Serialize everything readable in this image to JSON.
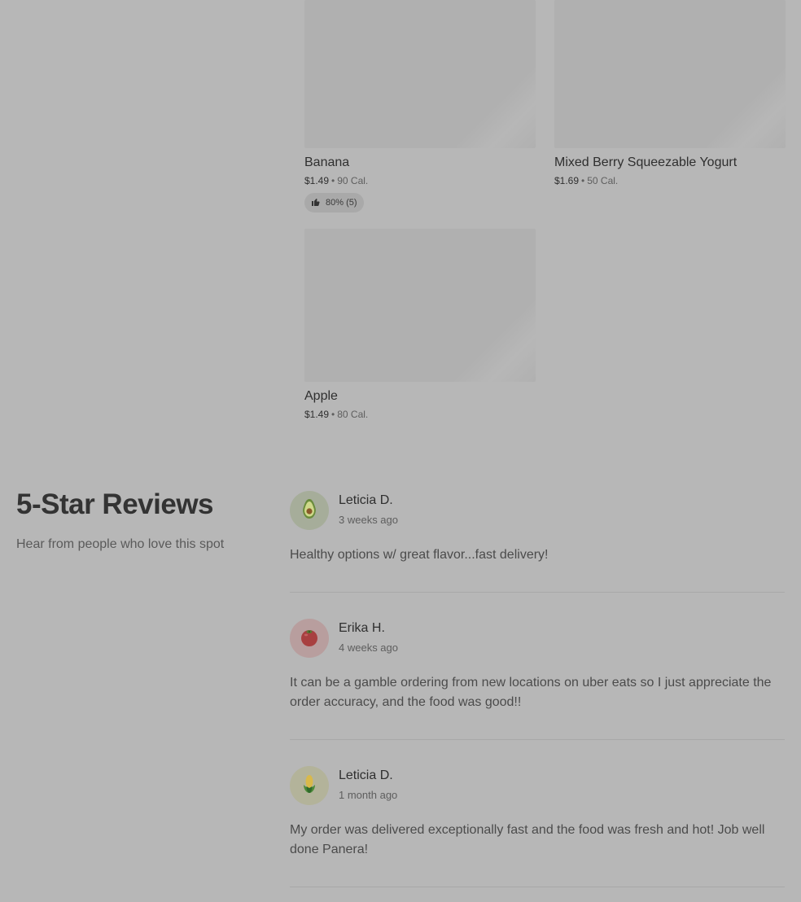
{
  "products": [
    {
      "name": "Banana",
      "price": "$1.49",
      "separator": "•",
      "calories": "90 Cal.",
      "rating": {
        "text": "80% (5)",
        "icon": "thumbs-up-icon"
      }
    },
    {
      "name": "Mixed Berry Squeezable Yogurt",
      "price": "$1.69",
      "separator": "•",
      "calories": "50 Cal."
    },
    {
      "name": "Apple",
      "price": "$1.49",
      "separator": "•",
      "calories": "80 Cal."
    }
  ],
  "reviews_section": {
    "title": "5-Star Reviews",
    "subtitle": "Hear from people who love this spot"
  },
  "reviews": [
    {
      "author": "Leticia D.",
      "time": "3 weeks ago",
      "text": "Healthy options w/ great flavor...fast delivery!",
      "avatar": "avocado-icon",
      "avatar_bg": "#a6ad9a"
    },
    {
      "author": "Erika H.",
      "time": "4 weeks ago",
      "text": "It can be a gamble ordering from new locations on uber eats so I just appreciate the order accuracy, and the food was good!!",
      "avatar": "tomato-icon",
      "avatar_bg": "#b89e9e"
    },
    {
      "author": "Leticia D.",
      "time": "1 month ago",
      "text": "My order was delivered exceptionally fast and the food was fresh and hot! Job well done Panera!",
      "avatar": "corn-icon",
      "avatar_bg": "#b3b39a"
    }
  ]
}
